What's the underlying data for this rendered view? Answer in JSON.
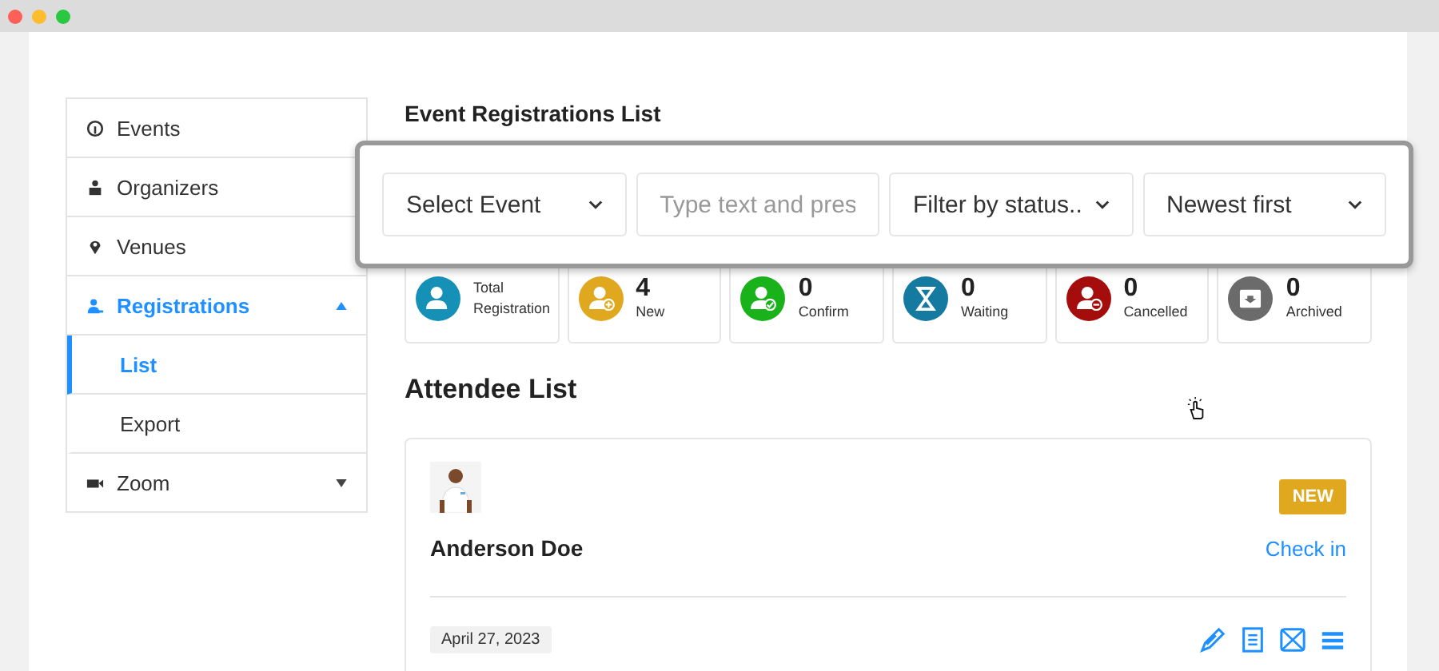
{
  "sidebar": {
    "items": [
      {
        "label": "Events",
        "kind": "events",
        "selected": false
      },
      {
        "label": "Organizers",
        "kind": "organizers",
        "selected": false
      },
      {
        "label": "Venues",
        "kind": "venues",
        "selected": false
      },
      {
        "label": "Registrations",
        "kind": "registrations",
        "selected": true,
        "expanded": true,
        "children": [
          {
            "label": "List",
            "selected": true
          },
          {
            "label": "Export",
            "selected": false
          }
        ]
      },
      {
        "label": "Zoom",
        "kind": "zoom",
        "selected": false,
        "expanded": false
      }
    ]
  },
  "title": "Event Registrations List",
  "filters": [
    {
      "kind": "select",
      "value": "Select Event"
    },
    {
      "kind": "input",
      "placeholder": "Type text and pres"
    },
    {
      "kind": "select",
      "value": "Filter by status.."
    },
    {
      "kind": "select",
      "value": "Newest first"
    }
  ],
  "stats": [
    {
      "kind": "person",
      "label_lines": [
        "Total",
        "Registration"
      ],
      "color": "#1591b8"
    },
    {
      "kind": "person-add",
      "count": "4",
      "label_lines": [
        "New"
      ],
      "color": "#e0a81f"
    },
    {
      "kind": "person-check",
      "count": "0",
      "label_lines": [
        "Confirm"
      ],
      "color": "#1ab21a"
    },
    {
      "kind": "hourglass",
      "count": "0",
      "label_lines": [
        "Waiting"
      ],
      "color": "#157aa0"
    },
    {
      "kind": "person-remove",
      "count": "0",
      "label_lines": [
        "Cancelled"
      ],
      "color": "#a50d0d"
    },
    {
      "kind": "archive",
      "count": "0",
      "label_lines": [
        "Archived"
      ],
      "color": "#6b6b6b"
    }
  ],
  "attendee_heading": "Attendee List",
  "attendees": [
    {
      "name": "Anderson Doe",
      "status": "NEW",
      "action": "Check in",
      "date": "April 27, 2023"
    }
  ]
}
